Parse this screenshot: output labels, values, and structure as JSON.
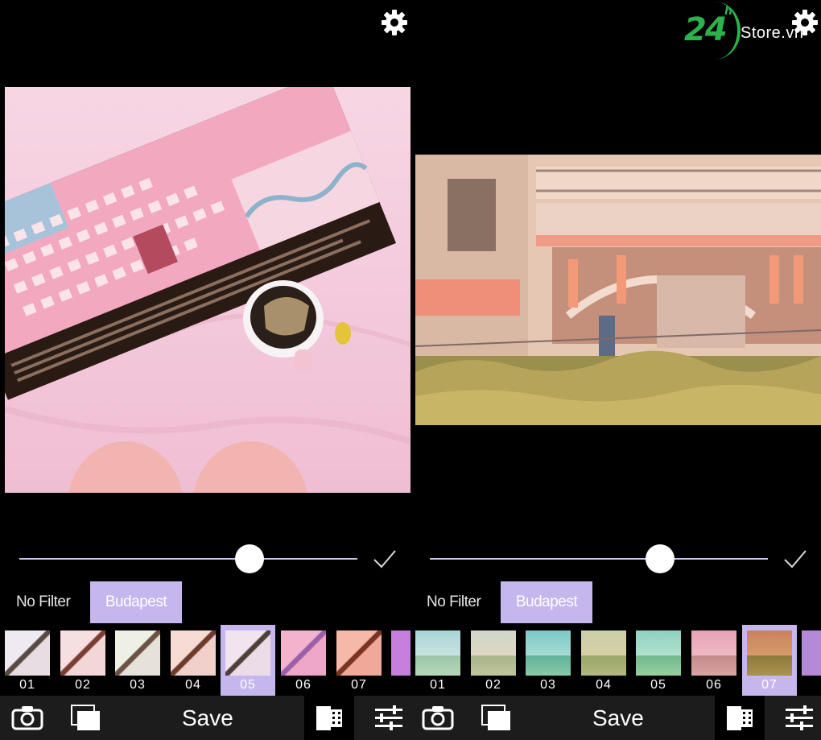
{
  "logo": {
    "number": "24",
    "superscript": "h",
    "text": "Store.vn"
  },
  "panels": [
    {
      "slider": {
        "level": 0.68
      },
      "categories": {
        "no_filter": "No Filter",
        "active": "Budapest"
      },
      "thumbnails": [
        "01",
        "02",
        "03",
        "04",
        "05",
        "06",
        "07",
        ""
      ],
      "selected_thumbnail": "05",
      "toolbar": {
        "save": "Save"
      }
    },
    {
      "slider": {
        "level": 0.68
      },
      "categories": {
        "no_filter": "No Filter",
        "active": "Budapest"
      },
      "thumbnails": [
        "01",
        "02",
        "03",
        "04",
        "05",
        "06",
        "07",
        ""
      ],
      "selected_thumbnail": "07",
      "toolbar": {
        "save": "Save"
      }
    }
  ],
  "colors": {
    "accent": "#c5b6ee",
    "logo_green": "#2bb24c",
    "toolbar": "#1c1c1c"
  },
  "icons": [
    "gear-icon",
    "check-icon",
    "camera-icon",
    "album-icon",
    "film-filter-icon",
    "sliders-adjust-icon"
  ]
}
